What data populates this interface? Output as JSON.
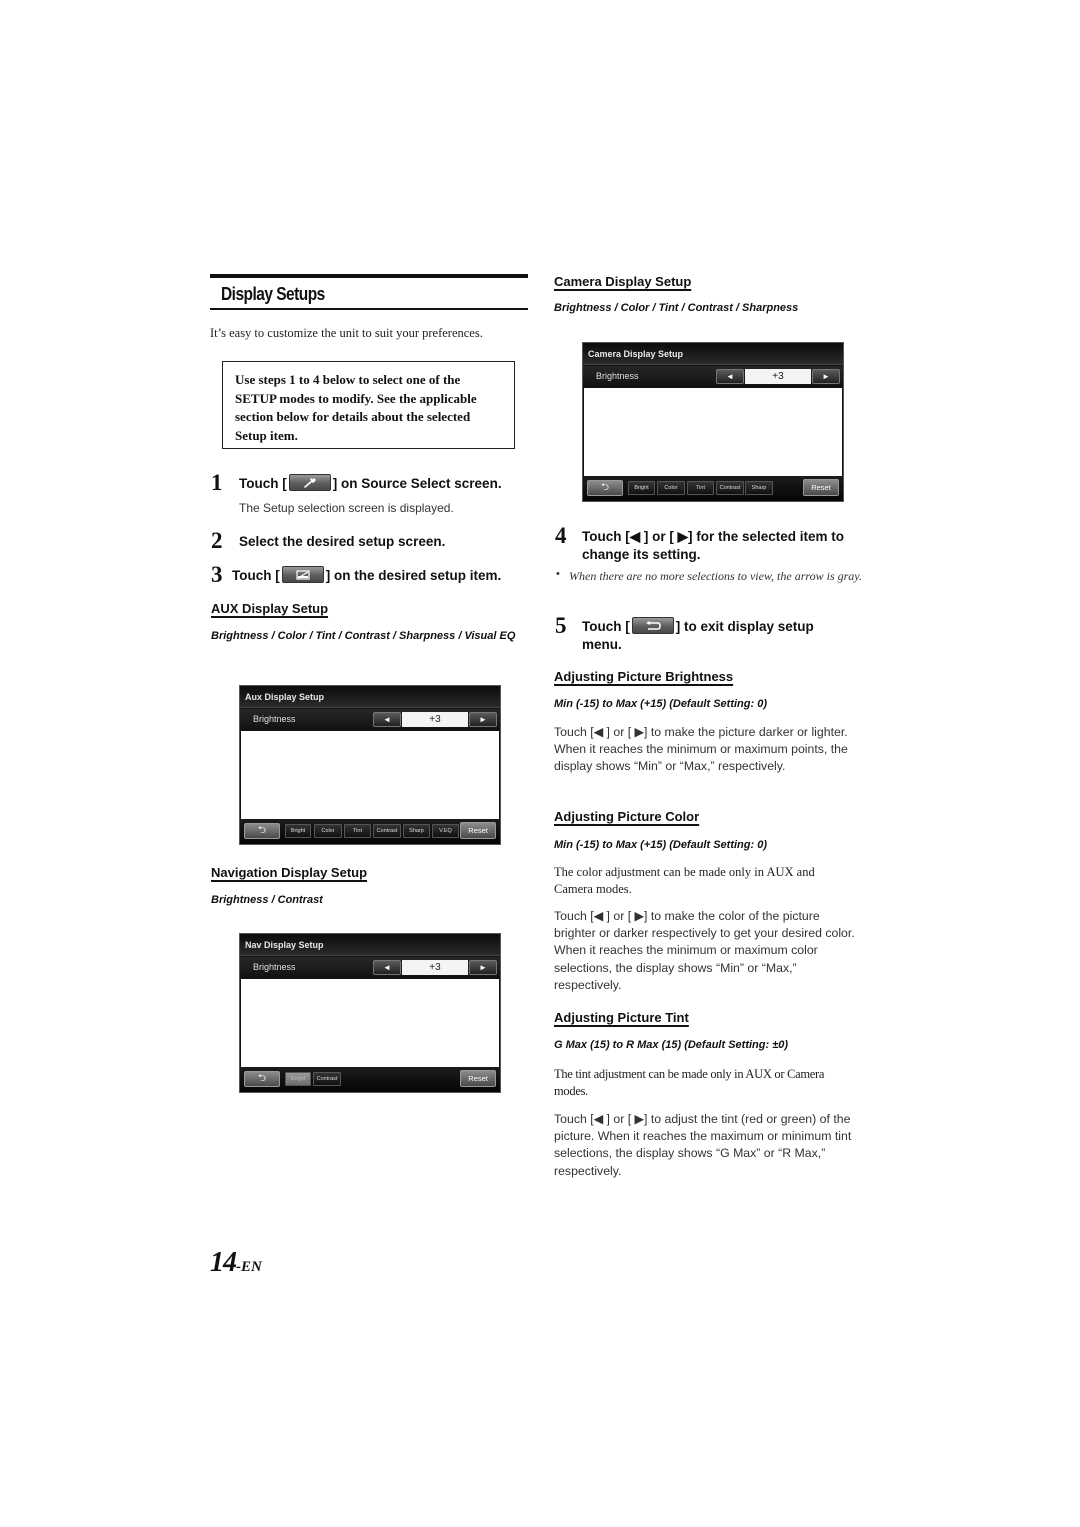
{
  "title": "Display Setups",
  "intro": "It’s easy to customize the unit to suit your preferences.",
  "note": "Use steps 1 to 4 below to select one of the SETUP modes to modify. See the applicable section below for details about the selected Setup item.",
  "steps": [
    {
      "num": "1",
      "pre": "Touch [",
      "icon": "wrench-icon",
      "post": "] on Source Select screen.",
      "sub": "The Setup selection screen is displayed."
    },
    {
      "num": "2",
      "text": "Select the desired setup screen."
    },
    {
      "num": "3",
      "pre": "Touch [",
      "icon": "display-adjust-icon",
      "post": "] on the desired setup item."
    },
    {
      "num": "4",
      "text": "Touch [◀ ] or [ ▶] for the selected item to change its setting.",
      "note": "When there are no more selections to view, the arrow is gray."
    },
    {
      "num": "5",
      "pre": "Touch [",
      "icon": "return-icon",
      "post": "] to exit display setup menu."
    }
  ],
  "sections": {
    "aux": {
      "heading": "AUX Display Setup",
      "items": "Brightness / Color / Tint / Contrast / Sharpness / Visual EQ",
      "screen": {
        "title": "Aux Display Setup",
        "row_label": "Brightness",
        "value": "+3",
        "left_arrow": "◄",
        "right_arrow": "►",
        "back_glyph": "⮌",
        "tabs": [
          "Bright",
          "Color",
          "Tint",
          "Contrast",
          "Sharp",
          "V.EQ"
        ],
        "reset": "Reset"
      }
    },
    "nav": {
      "heading": "Navigation Display Setup",
      "items": "Brightness / Contrast",
      "screen": {
        "title": "Nav Display Setup",
        "row_label": "Brightness",
        "value": "+3",
        "left_arrow": "◄",
        "right_arrow": "►",
        "back_glyph": "⮌",
        "tabs": [
          "Bright",
          "Contrast"
        ],
        "selected_tab": "Bright",
        "reset": "Reset"
      }
    },
    "camera": {
      "heading": "Camera Display Setup",
      "items": "Brightness / Color / Tint / Contrast / Sharpness",
      "screen": {
        "title": "Camera Display Setup",
        "row_label": "Brightness",
        "value": "+3",
        "left_arrow": "◄",
        "right_arrow": "►",
        "back_glyph": "⮌",
        "tabs": [
          "Bright",
          "Color",
          "Tint",
          "Contrast",
          "Sharp"
        ],
        "reset": "Reset"
      }
    },
    "brightness": {
      "heading": "Adjusting Picture Brightness",
      "range": "Min (-15) to Max (+15) (Default Setting: 0)",
      "body": "Touch [◀ ] or [ ▶] to make the picture darker or lighter. When it reaches the minimum or maximum points, the display shows “Min” or “Max,” respectively."
    },
    "color": {
      "heading": "Adjusting Picture Color",
      "range": "Min (-15) to Max (+15) (Default Setting: 0)",
      "note": "The color adjustment can be made only in AUX and Camera modes.",
      "body": "Touch [◀ ] or [ ▶] to make the color of the picture brighter or darker respectively to get your desired color. When it reaches the minimum or maximum color selections, the display shows “Min” or “Max,” respectively."
    },
    "tint": {
      "heading": "Adjusting Picture Tint",
      "range": "G Max (15) to R Max (15) (Default Setting: ±0)",
      "note": "The tint adjustment can be made only in AUX or Camera modes.",
      "body": "Touch [◀ ] or [ ▶] to adjust the tint (red or green) of the picture. When it reaches the maximum or minimum tint selections, the display shows “G Max” or “R Max,” respectively."
    }
  },
  "page_number": {
    "num": "14",
    "suffix": "-EN"
  }
}
